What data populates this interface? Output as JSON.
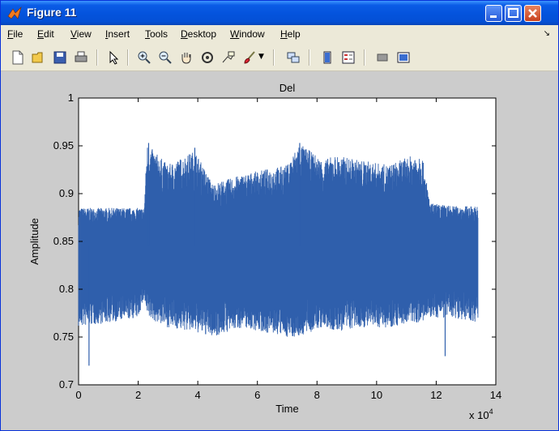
{
  "window": {
    "title": "Figure 11"
  },
  "menu": {
    "items": [
      "File",
      "Edit",
      "View",
      "Insert",
      "Tools",
      "Desktop",
      "Window",
      "Help"
    ]
  },
  "toolbar": {
    "icons": [
      "new-figure-icon",
      "open-file-icon",
      "save-icon",
      "print-icon",
      "pointer-arrow-icon",
      "zoom-in-icon",
      "zoom-out-icon",
      "pan-hand-icon",
      "rotate-3d-icon",
      "data-cursor-icon",
      "brush-icon",
      "dropdown-arrow-icon",
      "link-plot-icon",
      "colorbar-icon",
      "legend-icon",
      "hide-plot-tools-icon",
      "show-plot-tools-icon"
    ]
  },
  "colors": {
    "series": "#2f5fac",
    "titlebar": "#0453dc",
    "figure_bg": "#cccccc"
  },
  "chart_data": {
    "type": "line",
    "title": "Del",
    "xlabel": "Time",
    "ylabel": "Amplitude",
    "xlim": [
      0,
      14
    ],
    "ylim": [
      0.7,
      1.0
    ],
    "x_multiplier": "x 10^4",
    "x_multiplier_base": "x 10",
    "x_multiplier_exp": "4",
    "xticks": [
      0,
      2,
      4,
      6,
      8,
      10,
      12,
      14
    ],
    "xtick_labels": [
      "0",
      "2",
      "4",
      "6",
      "8",
      "10",
      "12",
      "14"
    ],
    "yticks": [
      0.7,
      0.75,
      0.8,
      0.85,
      0.9,
      0.95,
      1.0
    ],
    "ytick_labels": [
      "0.7",
      "0.75",
      "0.8",
      "0.85",
      "0.9",
      "0.95",
      "1"
    ],
    "grid": false,
    "series": [
      {
        "x_range": [
          0,
          13.4
        ],
        "envelope_x": [
          0,
          1,
          2,
          2.2,
          2.3,
          3,
          3.9,
          4.5,
          5.5,
          6.2,
          7,
          7.4,
          8.2,
          8.6,
          9.5,
          10.4,
          11.2,
          11.5,
          11.8,
          12.6,
          13.4
        ],
        "envelope_upper": [
          0.885,
          0.885,
          0.885,
          0.885,
          0.952,
          0.93,
          0.945,
          0.91,
          0.92,
          0.925,
          0.93,
          0.953,
          0.935,
          0.94,
          0.935,
          0.93,
          0.94,
          0.945,
          0.89,
          0.887,
          0.887
        ],
        "envelope_lower": [
          0.76,
          0.765,
          0.77,
          0.79,
          0.77,
          0.76,
          0.755,
          0.75,
          0.76,
          0.755,
          0.75,
          0.75,
          0.76,
          0.755,
          0.76,
          0.76,
          0.765,
          0.765,
          0.77,
          0.77,
          0.765
        ],
        "spikes": [
          {
            "x": 0.35,
            "y": 0.72
          },
          {
            "x": 12.3,
            "y": 0.73
          },
          {
            "x": 2.35,
            "y": 0.953
          },
          {
            "x": 7.42,
            "y": 0.953
          },
          {
            "x": 3.9,
            "y": 0.948
          }
        ]
      }
    ]
  }
}
